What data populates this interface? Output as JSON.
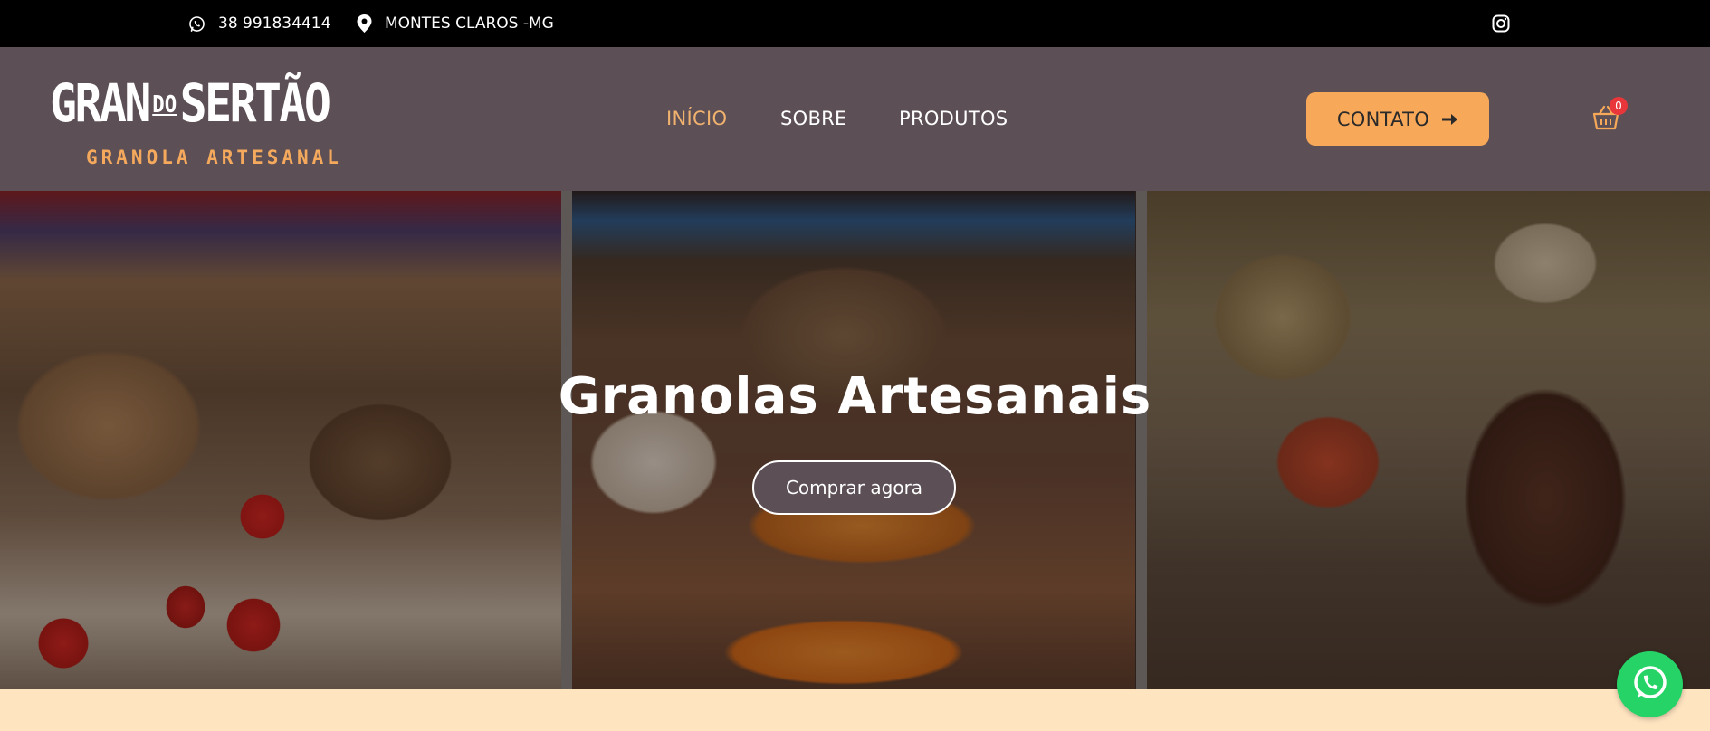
{
  "topbar": {
    "phone": "38 991834414",
    "location": "MONTES CLAROS -MG",
    "phone_icon": "whatsapp-icon",
    "location_icon": "map-pin-icon",
    "social_icon": "instagram-icon"
  },
  "logo": {
    "main_left": "GRAN",
    "main_do": "DO",
    "main_right": "SERTÃO",
    "sub": "GRANOLA ARTESANAL"
  },
  "nav": {
    "items": [
      {
        "label": "INÍCIO",
        "active": true
      },
      {
        "label": "SOBRE",
        "active": false
      },
      {
        "label": "PRODUTOS",
        "active": false
      }
    ]
  },
  "header": {
    "contact_label": "CONTATO",
    "cart_count": "0"
  },
  "hero": {
    "title": "Granolas Artesanais",
    "button_label": "Comprar agora"
  },
  "colors": {
    "topbar": "#000000",
    "header": "#5c4f55",
    "accent": "#f7a859",
    "nav_active": "#f0b26e",
    "footer_band": "#ffe4c0",
    "whatsapp": "#25d366"
  }
}
